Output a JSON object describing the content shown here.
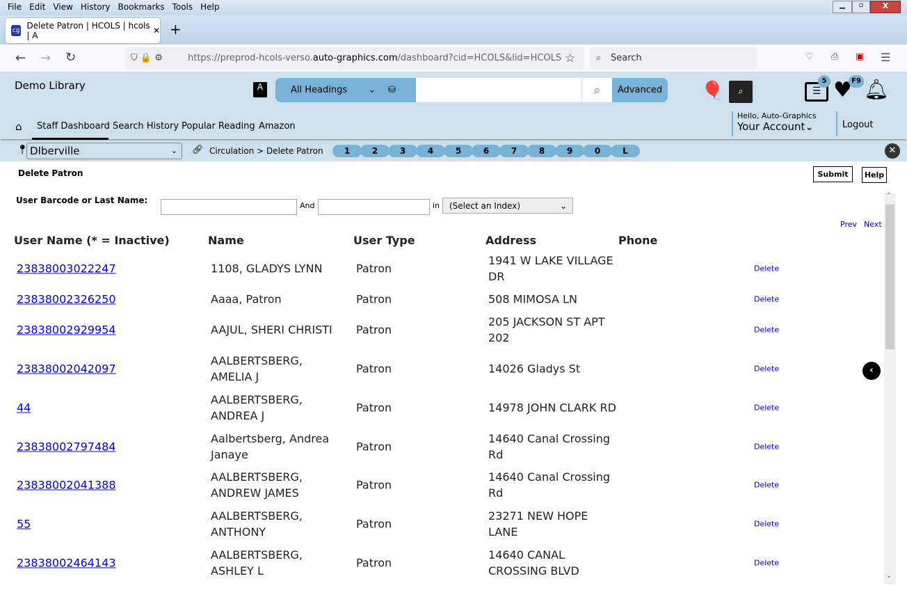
{
  "browser": {
    "menu": [
      "File",
      "Edit",
      "View",
      "History",
      "Bookmarks",
      "Tools",
      "Help"
    ],
    "tab_title": "Delete Patron | HCOLS | hcols | A",
    "url_pre": "https://preprod-hcols-verso.",
    "url_domain": "auto-graphics.com",
    "url_post": "/dashboard?cid=HCOLS&lid=HCOLS",
    "search_placeholder": "Search"
  },
  "header": {
    "library": "Demo Library",
    "heading_select": "All Headings",
    "advanced": "Advanced",
    "list_badge": "5",
    "fav_badge": "F9",
    "hello": "Hello, Auto-Graphics",
    "account": "Your Account",
    "logout": "Logout"
  },
  "nav": [
    "Staff Dashboard",
    "Search History",
    "Popular Reading",
    "Amazon"
  ],
  "location": "DIberville",
  "breadcrumb": "Circulation > Delete Patron",
  "alpha": [
    "1",
    "2",
    "3",
    "4",
    "5",
    "6",
    "7",
    "8",
    "9",
    "0",
    "L"
  ],
  "page": {
    "title": "Delete Patron",
    "submit": "Submit",
    "help": "Help",
    "search_label": "User Barcode or Last Name:",
    "and": "And",
    "in": "in",
    "index_select": "(Select an Index)",
    "prev": "Prev",
    "next": "Next"
  },
  "columns": [
    "User Name (* = Inactive)",
    "Name",
    "User Type",
    "Address",
    "Phone"
  ],
  "rows": [
    {
      "user": "23838003022247",
      "name": "1108, GLADYS LYNN",
      "type": "Patron",
      "address": "1941 W LAKE VILLAGE DR",
      "action": "Delete"
    },
    {
      "user": "23838002326250",
      "name": "Aaaa, Patron",
      "type": "Patron",
      "address": "508 MIMOSA LN",
      "action": "Delete"
    },
    {
      "user": "23838002929954",
      "name": "AAJUL, SHERI CHRISTI",
      "type": "Patron",
      "address": "205 JACKSON ST APT 202",
      "action": "Delete"
    },
    {
      "user": "23838002042097",
      "name": "AALBERTSBERG, AMELIA J",
      "type": "Patron",
      "address": "14026 Gladys St",
      "action": "Delete"
    },
    {
      "user": "44",
      "name": "AALBERTSBERG, ANDREA J",
      "type": "Patron",
      "address": "14978 JOHN CLARK RD",
      "action": "Delete"
    },
    {
      "user": "23838002797484",
      "name": "Aalbertsberg, Andrea Janaye",
      "type": "Patron",
      "address": "14640 Canal Crossing Rd",
      "action": "Delete"
    },
    {
      "user": "23838002041388",
      "name": "AALBERTSBERG, ANDREW JAMES",
      "type": "Patron",
      "address": "14640 Canal Crossing Rd",
      "action": "Delete"
    },
    {
      "user": "55",
      "name": "AALBERTSBERG, ANTHONY",
      "type": "Patron",
      "address": "23271 NEW HOPE LANE",
      "action": "Delete"
    },
    {
      "user": "23838002464143",
      "name": "AALBERTSBERG, ASHLEY L",
      "type": "Patron",
      "address": "14640 CANAL CROSSING BLVD",
      "action": "Delete"
    }
  ]
}
